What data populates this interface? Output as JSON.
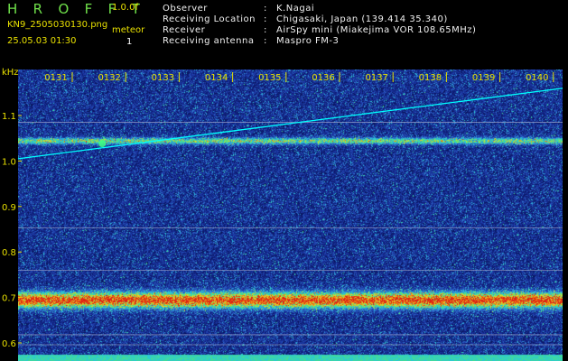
{
  "header": {
    "app_title": "H R O F F T",
    "version": "1.0.0f",
    "filename": "KN9_2505030130.png",
    "timestamp": "25.05.03 01:30",
    "meteor_label": "meteor",
    "meteor_count": "1"
  },
  "station_info": [
    {
      "label": "Observer",
      "value": "K.Nagai"
    },
    {
      "label": "Receiving Location",
      "value": "Chigasaki, Japan (139.414 35.340)"
    },
    {
      "label": "Receiver",
      "value": "AirSpy mini (Miakejima VOR 108.65MHz)"
    },
    {
      "label": "Receiving antenna",
      "value": "Maspro FM-3"
    }
  ],
  "axis": {
    "y_unit": "kHz",
    "y_ticks": [
      "1.1",
      "1.0",
      "0.9",
      "0.8",
      "0.7",
      "0.6"
    ],
    "time_ticks": [
      "0131",
      "0132",
      "0133",
      "0134",
      "0135",
      "0136",
      "0137",
      "0138",
      "0139",
      "0140"
    ]
  },
  "colors": {
    "background": "#000000",
    "text_yellow": "#e8e000",
    "title_green": "#6fe04a",
    "noise_blue": "#1a2a8a",
    "trace_cyan": "#00ffff"
  },
  "chart_data": {
    "type": "heatmap",
    "y_unit": "kHz",
    "y_range": [
      0.58,
      1.16
    ],
    "time_range": [
      "0130",
      "0140"
    ],
    "bands_khz": [
      {
        "center": 1.045,
        "strength": 0.55
      },
      {
        "center": 0.695,
        "strength": 1.0
      }
    ],
    "reference_lines_khz": [
      1.085,
      0.853,
      0.76,
      0.618,
      0.596
    ],
    "drift_trace": {
      "start": {
        "time": "0130",
        "khz": 1.005
      },
      "end": {
        "time": "0140",
        "khz": 1.16
      }
    },
    "meteor_echo": {
      "time": "0132",
      "khz": 1.05
    }
  }
}
